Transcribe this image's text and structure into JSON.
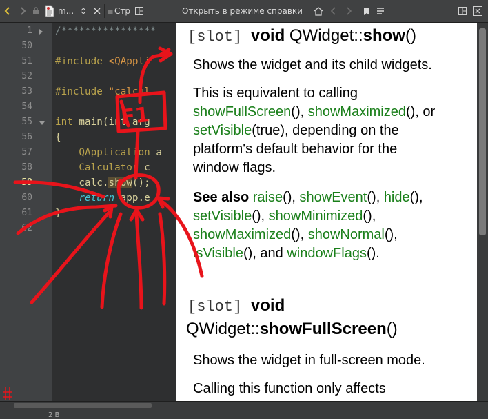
{
  "editor": {
    "toolbar": {
      "file_name": "m...",
      "tab_stub": "Стр",
      "split_icon": "split-icon"
    },
    "line_numbers": [
      "1",
      "50",
      "51",
      "52",
      "53",
      "54",
      "55",
      "56",
      "57",
      "58",
      "59",
      "60",
      "61",
      "62"
    ],
    "current_line": "59",
    "code": {
      "l1": "/****************",
      "l51_directive": "#include",
      "l51_header": " <QAppli",
      "l53_directive": "#include",
      "l53_header": " \"calcul",
      "l55_type": "int",
      "l55_rest": " main(int arg",
      "l56": "{",
      "l57_type": "    QApplication",
      "l57_rest": " a",
      "l58_type": "    Calculator",
      "l58_rest": " c",
      "l59_pre": "    calc.",
      "l59_token": "show",
      "l59_post": "();",
      "l60_kw": "    return",
      "l60_rest": " app.e",
      "l61": "}"
    },
    "status_text": "2 B"
  },
  "help": {
    "toolbar": {
      "mode_label": "Открыть в режиме справки"
    },
    "sections": {
      "show": {
        "slot": "[slot]",
        "void": "void",
        "class": "QWidget::",
        "name": "show",
        "parens": "()",
        "p1": "Shows the widget and its child widgets.",
        "p2_a": "This is equivalent to calling",
        "p2_link1": "showFullScreen",
        "p2_b": "(), ",
        "p2_link2": "showMaximized",
        "p2_c": "(), or",
        "p2_link3": "setVisible",
        "p2_d": "(true), depending on the",
        "p2_e": "platform's default behavior for the",
        "p2_f": "window flags.",
        "see_also": "See also",
        "sa_raise": "raise",
        "sa_showEvent": "showEvent",
        "sa_hide": "hide",
        "sa_setVisible": "setVisible",
        "sa_showMinimized": "showMinimized",
        "sa_showMaximized": "showMaximized",
        "sa_showNormal": "showNormal",
        "sa_isVisible": "isVisible",
        "sa_and": "(), and ",
        "sa_windowFlags": "windowFlags",
        "paren_comma": "(), ",
        "paren_comma_end": "(),",
        "paren_period": "()."
      },
      "fullscreen": {
        "slot": "[slot]",
        "void": "void",
        "class": "QWidget::",
        "name": "showFullScreen",
        "parens": "()",
        "p1": "Shows the widget in full-screen mode.",
        "p2": "Calling this function only affects"
      }
    }
  },
  "annotation": {
    "key_label": "F1",
    "color": "#e8141b"
  },
  "colors": {
    "editor_bg": "#2e2f30",
    "gutter_bg": "#404244",
    "link_green": "#1a7f1a",
    "toolbar_bg": "#404142"
  }
}
